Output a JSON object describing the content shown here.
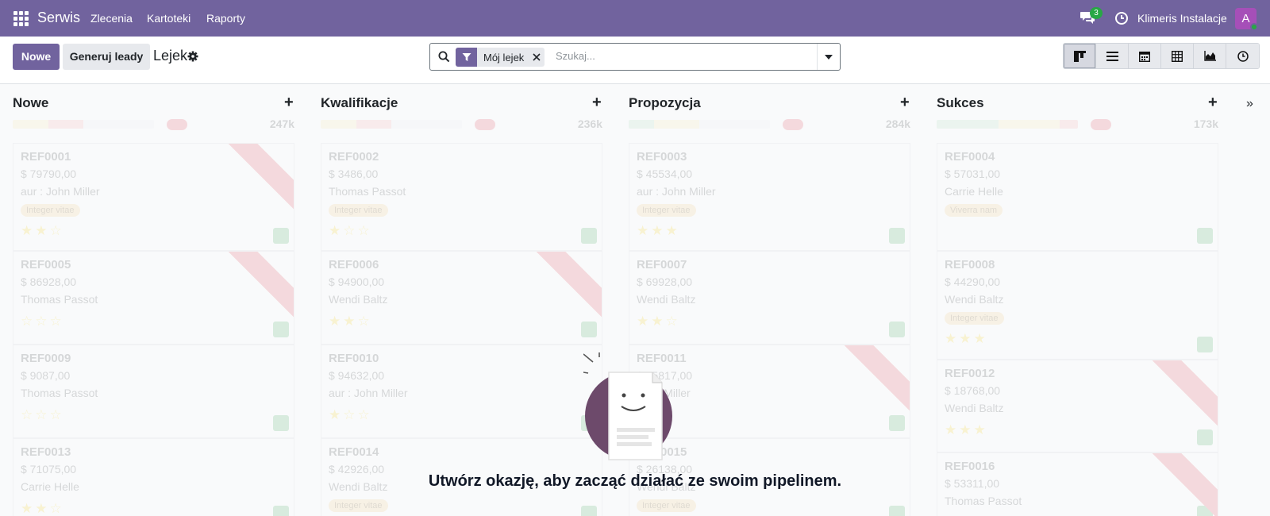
{
  "navbar": {
    "app_name": "Serwis",
    "menu": [
      "Zlecenia",
      "Kartoteki",
      "Raporty"
    ],
    "messages_count": "3",
    "company": "Klimeris Instalacje",
    "user_initial": "A",
    "bg_color": "#71639e"
  },
  "control_panel": {
    "new_label": "Nowe",
    "generate_label": "Generuj leady",
    "title": "Lejek",
    "search": {
      "facet": "Mój lejek",
      "placeholder": "Szukaj..."
    },
    "views": [
      "kanban",
      "list",
      "calendar",
      "pivot",
      "graph",
      "activity"
    ],
    "active_view": "kanban"
  },
  "kanban": {
    "columns": [
      {
        "title": "Nowe",
        "sum": "247k",
        "cards": [
          {
            "ref": "REF0001",
            "amount": "$ 79790,00",
            "person": "aur : John Miller",
            "tag": "Integer vitae",
            "stars": "★★☆"
          },
          {
            "ref": "REF0005",
            "amount": "$ 86928,00",
            "person": "Thomas Passot",
            "tag": "",
            "stars": "☆☆☆"
          },
          {
            "ref": "REF0009",
            "amount": "$ 9087,00",
            "person": "Thomas Passot",
            "tag": "",
            "stars": "☆☆☆"
          },
          {
            "ref": "REF0013",
            "amount": "$ 71075,00",
            "person": "Carrie Helle",
            "tag": "",
            "stars": "★★☆"
          }
        ]
      },
      {
        "title": "Kwalifikacje",
        "sum": "236k",
        "cards": [
          {
            "ref": "REF0002",
            "amount": "$ 3486,00",
            "person": "Thomas Passot",
            "tag": "Integer vitae",
            "stars": "★☆☆"
          },
          {
            "ref": "REF0006",
            "amount": "$ 94900,00",
            "person": "Wendi Baltz",
            "tag": "",
            "stars": "★★☆"
          },
          {
            "ref": "REF0010",
            "amount": "$ 94632,00",
            "person": "aur : John Miller",
            "tag": "",
            "stars": "★☆☆"
          },
          {
            "ref": "REF0014",
            "amount": "$ 42926,00",
            "person": "Wendi Baltz",
            "tag": "Integer vitae",
            "stars": ""
          }
        ]
      },
      {
        "title": "Propozycja",
        "sum": "284k",
        "cards": [
          {
            "ref": "REF0003",
            "amount": "$ 45534,00",
            "person": "aur : John Miller",
            "tag": "Integer vitae",
            "stars": "★★★"
          },
          {
            "ref": "REF0007",
            "amount": "$ 69928,00",
            "person": "Wendi Baltz",
            "tag": "",
            "stars": "★★☆"
          },
          {
            "ref": "REF0011",
            "amount": "$ 55817,00",
            "person": "John Miller",
            "tag": "",
            "stars": ""
          },
          {
            "ref": "REF0015",
            "amount": "$ 26138,00",
            "person": "Wendi Baltz",
            "tag": "Integer vitae",
            "stars": ""
          }
        ]
      },
      {
        "title": "Sukces",
        "sum": "173k",
        "cards": [
          {
            "ref": "REF0004",
            "amount": "$ 57031,00",
            "person": "Carrie Helle",
            "tag": "Viverra nam",
            "stars": ""
          },
          {
            "ref": "REF0008",
            "amount": "$ 44290,00",
            "person": "Wendi Baltz",
            "tag": "Integer vitae",
            "stars": "★★★"
          },
          {
            "ref": "REF0012",
            "amount": "$ 18768,00",
            "person": "Wendi Baltz",
            "tag": "",
            "stars": "★★★"
          },
          {
            "ref": "REF0016",
            "amount": "$ 53311,00",
            "person": "Thomas Passot",
            "tag": "",
            "stars": ""
          }
        ]
      }
    ]
  },
  "helper": {
    "message": "Utwórz okazję, aby zacząć działać ze swoim pipelinem."
  }
}
